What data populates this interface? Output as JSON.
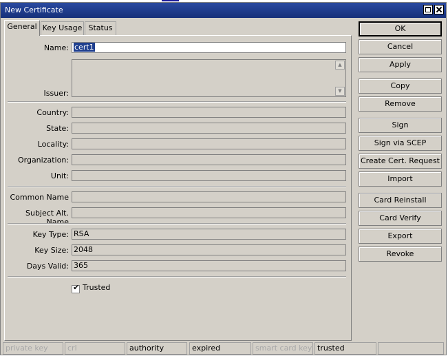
{
  "window": {
    "title": "New Certificate"
  },
  "tabs": [
    {
      "label": "General"
    },
    {
      "label": "Key Usage"
    },
    {
      "label": "Status"
    }
  ],
  "form": {
    "name": {
      "label": "Name:",
      "value": "cert1"
    },
    "issuer": {
      "label": "Issuer:",
      "value": ""
    },
    "country": {
      "label": "Country:",
      "value": ""
    },
    "state": {
      "label": "State:",
      "value": ""
    },
    "locality": {
      "label": "Locality:",
      "value": ""
    },
    "organization": {
      "label": "Organization:",
      "value": ""
    },
    "unit": {
      "label": "Unit:",
      "value": ""
    },
    "common_name": {
      "label": "Common Name",
      "value": ""
    },
    "subject_alt_name": {
      "label": "Subject Alt. Name",
      "value": ""
    },
    "key_type": {
      "label": "Key Type:",
      "value": "RSA"
    },
    "key_size": {
      "label": "Key Size:",
      "value": "2048"
    },
    "days_valid": {
      "label": "Days Valid:",
      "value": "365"
    },
    "trusted": {
      "label": "Trusted",
      "checked": true
    }
  },
  "buttons": {
    "ok": "OK",
    "cancel": "Cancel",
    "apply": "Apply",
    "copy": "Copy",
    "remove": "Remove",
    "sign": "Sign",
    "sign_via_scep": "Sign via SCEP",
    "create_cert_request": "Create Cert. Request",
    "import": "Import",
    "card_reinstall": "Card Reinstall",
    "card_verify": "Card Verify",
    "export": "Export",
    "revoke": "Revoke"
  },
  "status": {
    "private_key": "private key",
    "crl": "crl",
    "authority": "authority",
    "expired": "expired",
    "smart_card_key": "smart card key",
    "trusted": "trusted",
    "empty": ""
  },
  "colors": {
    "title_bar": "#1f3f8f",
    "window_bg": "#d4d0c8"
  }
}
